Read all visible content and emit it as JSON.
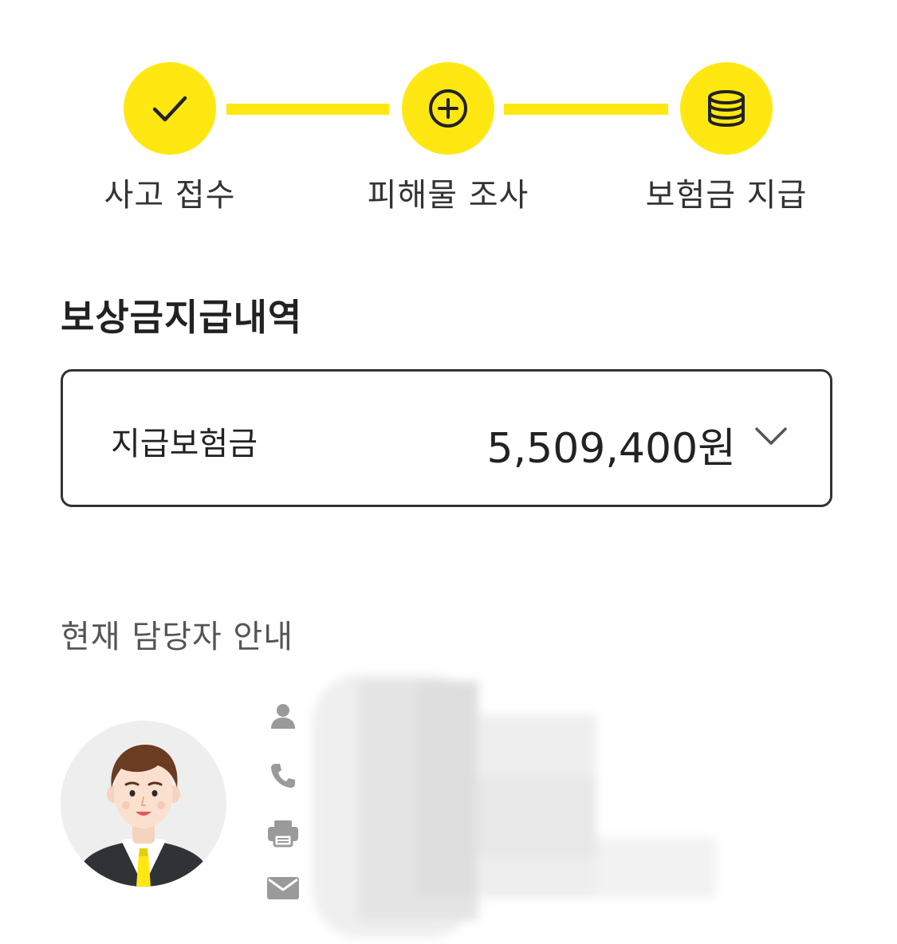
{
  "steps": [
    {
      "label": "사고 접수",
      "icon": "check-icon"
    },
    {
      "label": "피해물 조사",
      "icon": "plus-circle-icon"
    },
    {
      "label": "보험금 지급",
      "icon": "coins-stack-icon"
    }
  ],
  "colors": {
    "accent": "#FFE812",
    "text": "#222222",
    "border": "#333333",
    "icon_gray": "#9a9a9a"
  },
  "payment": {
    "section_title": "보상금지급내역",
    "label": "지급보험금",
    "amount": "5,509,400원",
    "expand_icon": "chevron-down-icon"
  },
  "manager": {
    "section_title": "현재 담당자 안내",
    "avatar": "avatar-illustration",
    "fields": [
      {
        "icon": "person-icon"
      },
      {
        "icon": "phone-icon"
      },
      {
        "icon": "fax-icon"
      },
      {
        "icon": "mail-icon"
      }
    ]
  }
}
